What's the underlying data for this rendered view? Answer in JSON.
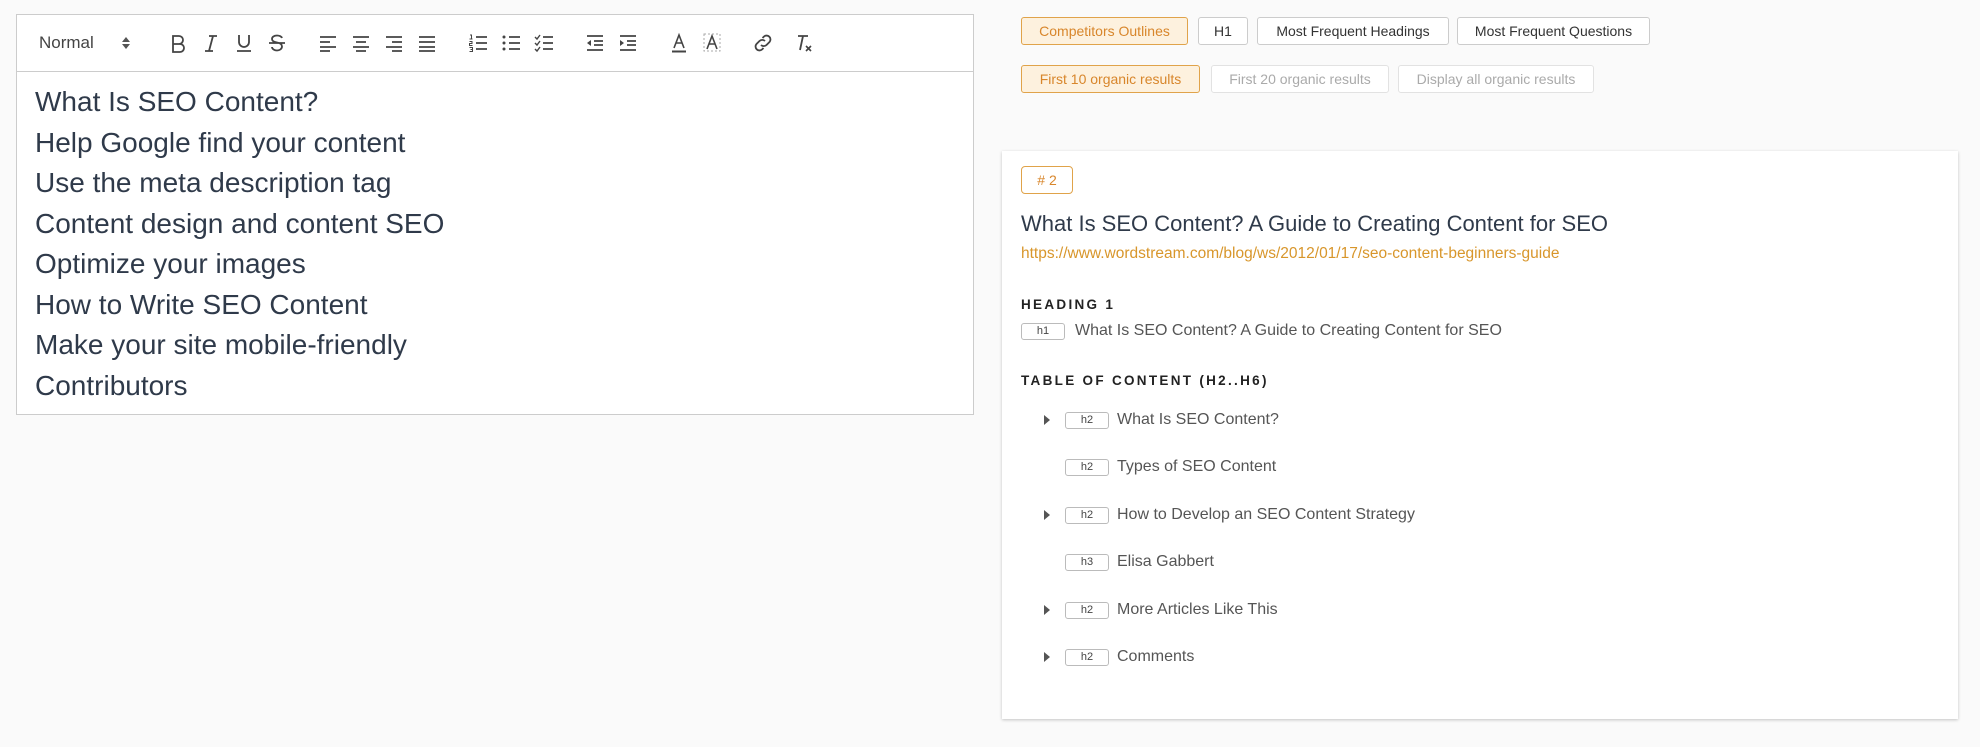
{
  "editor": {
    "format_select": "Normal",
    "lines": [
      "What Is SEO Content?",
      "Help Google find your content",
      "Use the meta description tag",
      "Content design and content SEO",
      "Optimize your images",
      "How to Write SEO Content",
      "Make your site mobile-friendly",
      "Contributors"
    ]
  },
  "filters": {
    "modes": [
      "Competitors Outlines",
      "H1",
      "Most Frequent Headings",
      "Most Frequent Questions"
    ],
    "active_mode": "Competitors Outlines",
    "results": [
      "First 10 organic results",
      "First 20 organic results",
      "Display all organic results"
    ],
    "active_results": "First 10 organic results"
  },
  "result": {
    "rank": "# 2",
    "title": "What Is SEO Content? A Guide to Creating Content for SEO",
    "url": "https://www.wordstream.com/blog/ws/2012/01/17/seo-content-beginners-guide",
    "heading1_label": "HEADING 1",
    "h1_tag": "h1",
    "h1_text": "What Is SEO Content? A Guide to Creating Content for SEO",
    "toc_label": "TABLE OF CONTENT (H2..H6)",
    "toc": [
      {
        "tag": "h2",
        "text": "What Is SEO Content?",
        "expandable": true
      },
      {
        "tag": "h2",
        "text": "Types of SEO Content",
        "expandable": false
      },
      {
        "tag": "h2",
        "text": "How to Develop an SEO Content Strategy",
        "expandable": true
      },
      {
        "tag": "h3",
        "text": "Elisa Gabbert",
        "expandable": false
      },
      {
        "tag": "h2",
        "text": "More Articles Like This",
        "expandable": true
      },
      {
        "tag": "h2",
        "text": "Comments",
        "expandable": true
      }
    ]
  },
  "colors": {
    "accent": "#d8862b",
    "accent_bg": "#fdf1de",
    "url": "#d8962b",
    "text_dark": "#2f3a4a"
  }
}
